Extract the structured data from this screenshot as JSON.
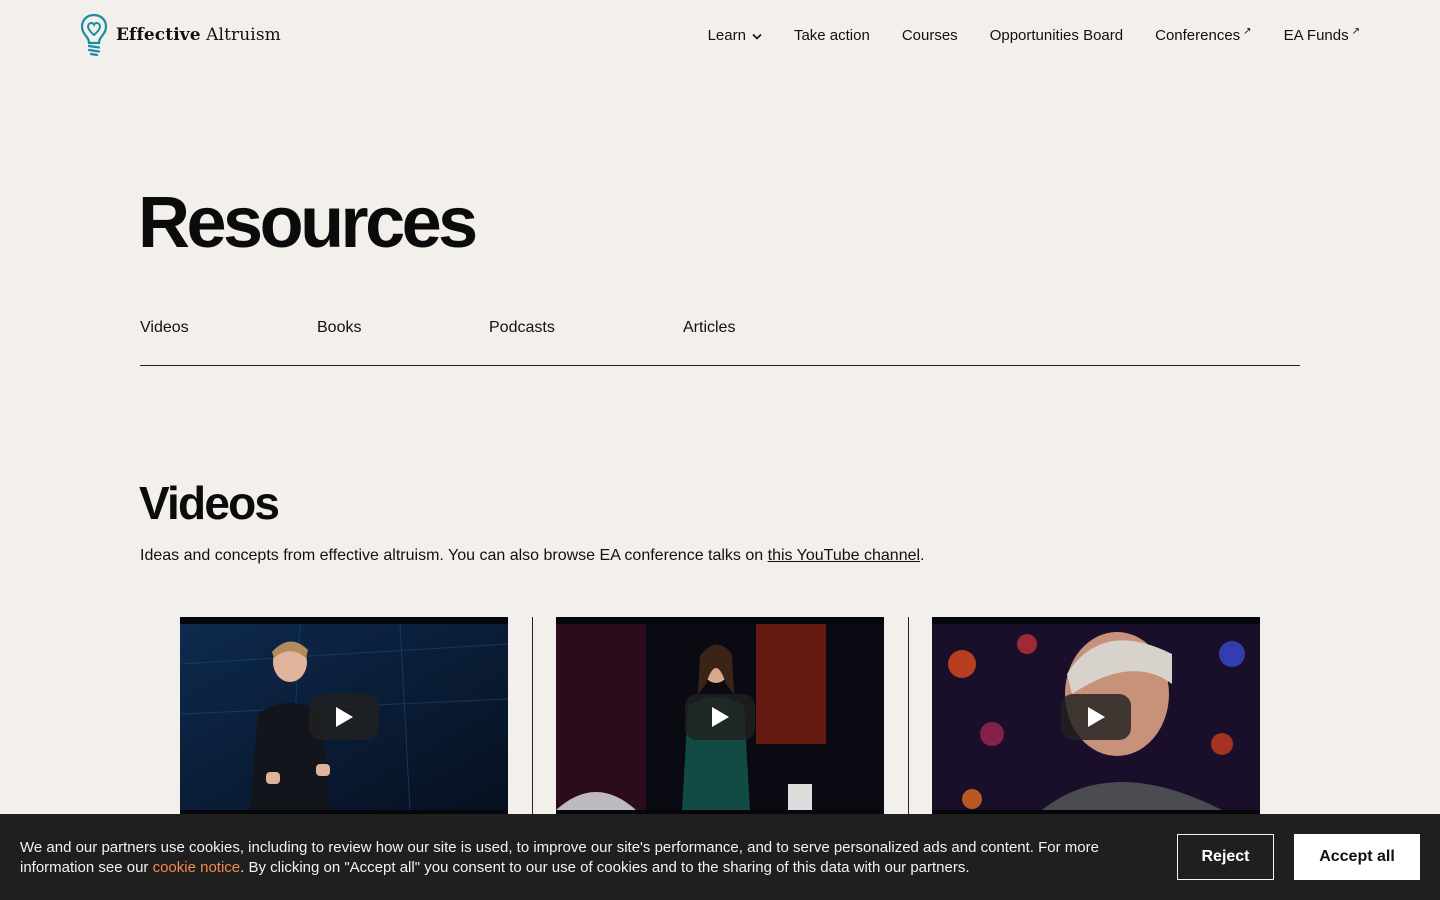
{
  "logo": {
    "brand_bold": "Effective",
    "brand_regular": "Altruism",
    "accent_color": "#1b8ca3"
  },
  "nav": {
    "items": [
      {
        "label": "Learn",
        "icon": "chevron-down-icon"
      },
      {
        "label": "Take action"
      },
      {
        "label": "Courses"
      },
      {
        "label": "Opportunities Board"
      },
      {
        "label": "Conferences",
        "icon": "external-link-icon"
      },
      {
        "label": "EA Funds",
        "icon": "external-link-icon"
      }
    ]
  },
  "page": {
    "title": "Resources"
  },
  "tabs": [
    "Videos",
    "Books",
    "Podcasts",
    "Articles"
  ],
  "videos_section": {
    "title": "Videos",
    "desc_before": "Ideas and concepts from effective altruism. You can also browse EA conference talks on ",
    "desc_link": "this YouTube channel",
    "desc_after": ".",
    "play_icon": "play-icon"
  },
  "cookie_banner": {
    "text_before": "We and our partners use cookies, including to review how our site is used, to improve our site's performance, and to serve personalized ads and content. For more information see our ",
    "link": "cookie notice",
    "text_after": ". By clicking on \"Accept all\" you consent to our use of cookies and to the sharing of this data with our partners.",
    "reject_label": "Reject",
    "accept_label": "Accept all",
    "link_color": "#f28a4c"
  }
}
